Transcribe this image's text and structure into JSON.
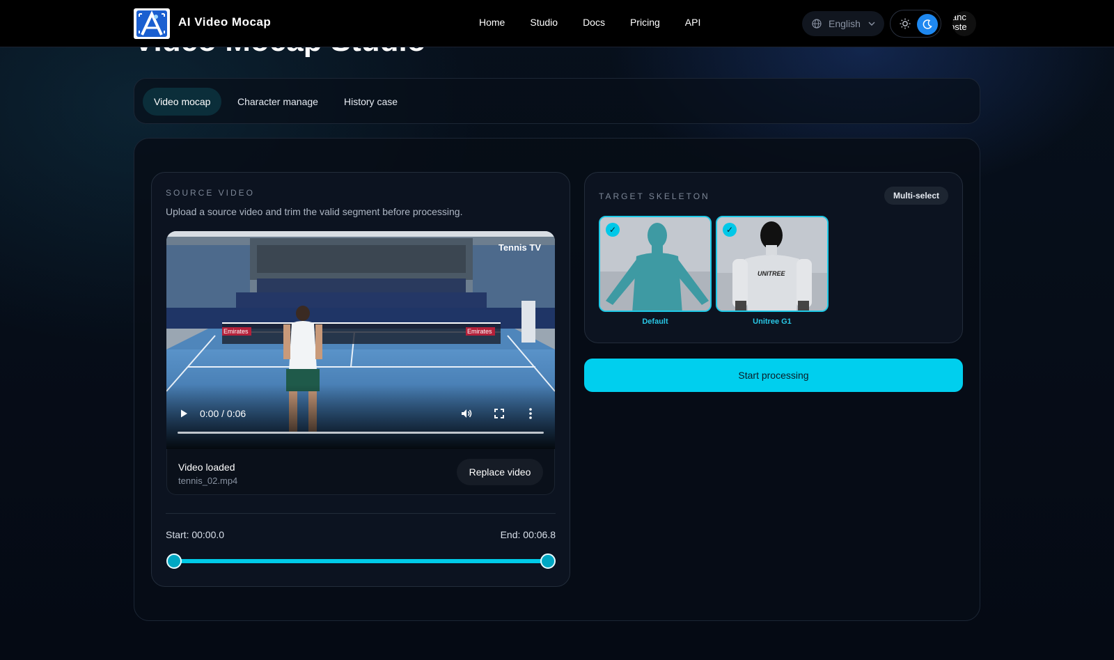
{
  "header": {
    "brand": "AI Video Mocap",
    "nav": [
      "Home",
      "Studio",
      "Docs",
      "Pricing",
      "API"
    ],
    "language": "English",
    "avatar_text": [
      "ianc",
      "oste"
    ]
  },
  "page": {
    "title": "Video Mocap Studio"
  },
  "tabs": [
    {
      "label": "Video mocap",
      "active": true
    },
    {
      "label": "Character manage",
      "active": false
    },
    {
      "label": "History case",
      "active": false
    }
  ],
  "source": {
    "heading": "SOURCE VIDEO",
    "description": "Upload a source video and trim the valid segment before processing.",
    "player": {
      "time": "0:00 / 0:06",
      "watermark": "Tennis TV",
      "banner_text": "Emirates"
    },
    "status": "Video loaded",
    "filename": "tennis_02.mp4",
    "replace_label": "Replace video",
    "start_label": "Start: 00:00.0",
    "end_label": "End: 00:06.8",
    "trim_start_fraction": 0.0,
    "trim_end_fraction": 1.0
  },
  "target": {
    "heading": "TARGET SKELETON",
    "multi_label": "Multi-select",
    "skeletons": [
      {
        "name": "Default",
        "selected": true,
        "brand_text": ""
      },
      {
        "name": "Unitree G1",
        "selected": true,
        "brand_text": "UNITREE"
      }
    ]
  },
  "actions": {
    "start_label": "Start processing"
  },
  "colors": {
    "accent": "#00cfee",
    "background": "#050a14",
    "check": "#00c8e8"
  }
}
